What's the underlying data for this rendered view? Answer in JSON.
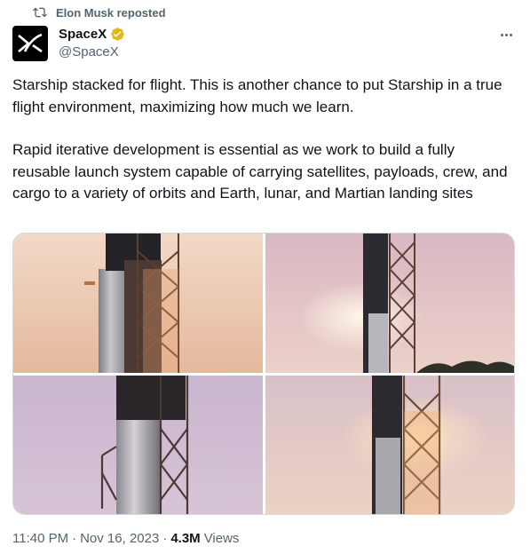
{
  "repost": {
    "text": "Elon Musk reposted",
    "icon": "repost-icon"
  },
  "author": {
    "name": "SpaceX",
    "handle": "@SpaceX",
    "verified_color": "#e2b719",
    "avatar_icon": "spacex-x-logo"
  },
  "more_icon": "more-horizontal-icon",
  "tweet": {
    "paragraph_1": "Starship stacked for flight. This is another chance to put Starship in a true flight environment, maximizing how much we learn.",
    "paragraph_2": "Rapid iterative development is essential as we work to build a fully reusable launch system capable of carrying satellites, payloads, crew, and cargo to a variety of orbits and Earth, lunar, and Martian landing sites"
  },
  "media": {
    "count": 4,
    "items": [
      "starship-photo-1",
      "starship-photo-2",
      "starship-photo-3",
      "starship-photo-4"
    ]
  },
  "meta": {
    "time": "11:40 PM",
    "separator_1": "·",
    "date": "Nov 16, 2023",
    "separator_2": "·",
    "views_count": "4.3M",
    "views_label": "Views"
  }
}
